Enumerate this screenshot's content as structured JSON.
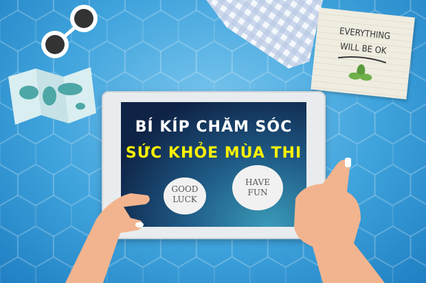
{
  "screen": {
    "title_line1": "BÍ KÍP CHĂM SÓC",
    "title_line2": "SỨC KHỎE MÙA THI",
    "bubble_left": [
      "GOOD",
      "LUCK"
    ],
    "bubble_right": [
      "HAVE",
      "FUN"
    ]
  },
  "note": {
    "line1": "EVERYTHING",
    "line2": "WILL BE OK"
  },
  "colors": {
    "background": "#3fa3dc",
    "title_highlight": "#fff200",
    "title_main": "#ffffff",
    "skin": "#f2b48f"
  }
}
